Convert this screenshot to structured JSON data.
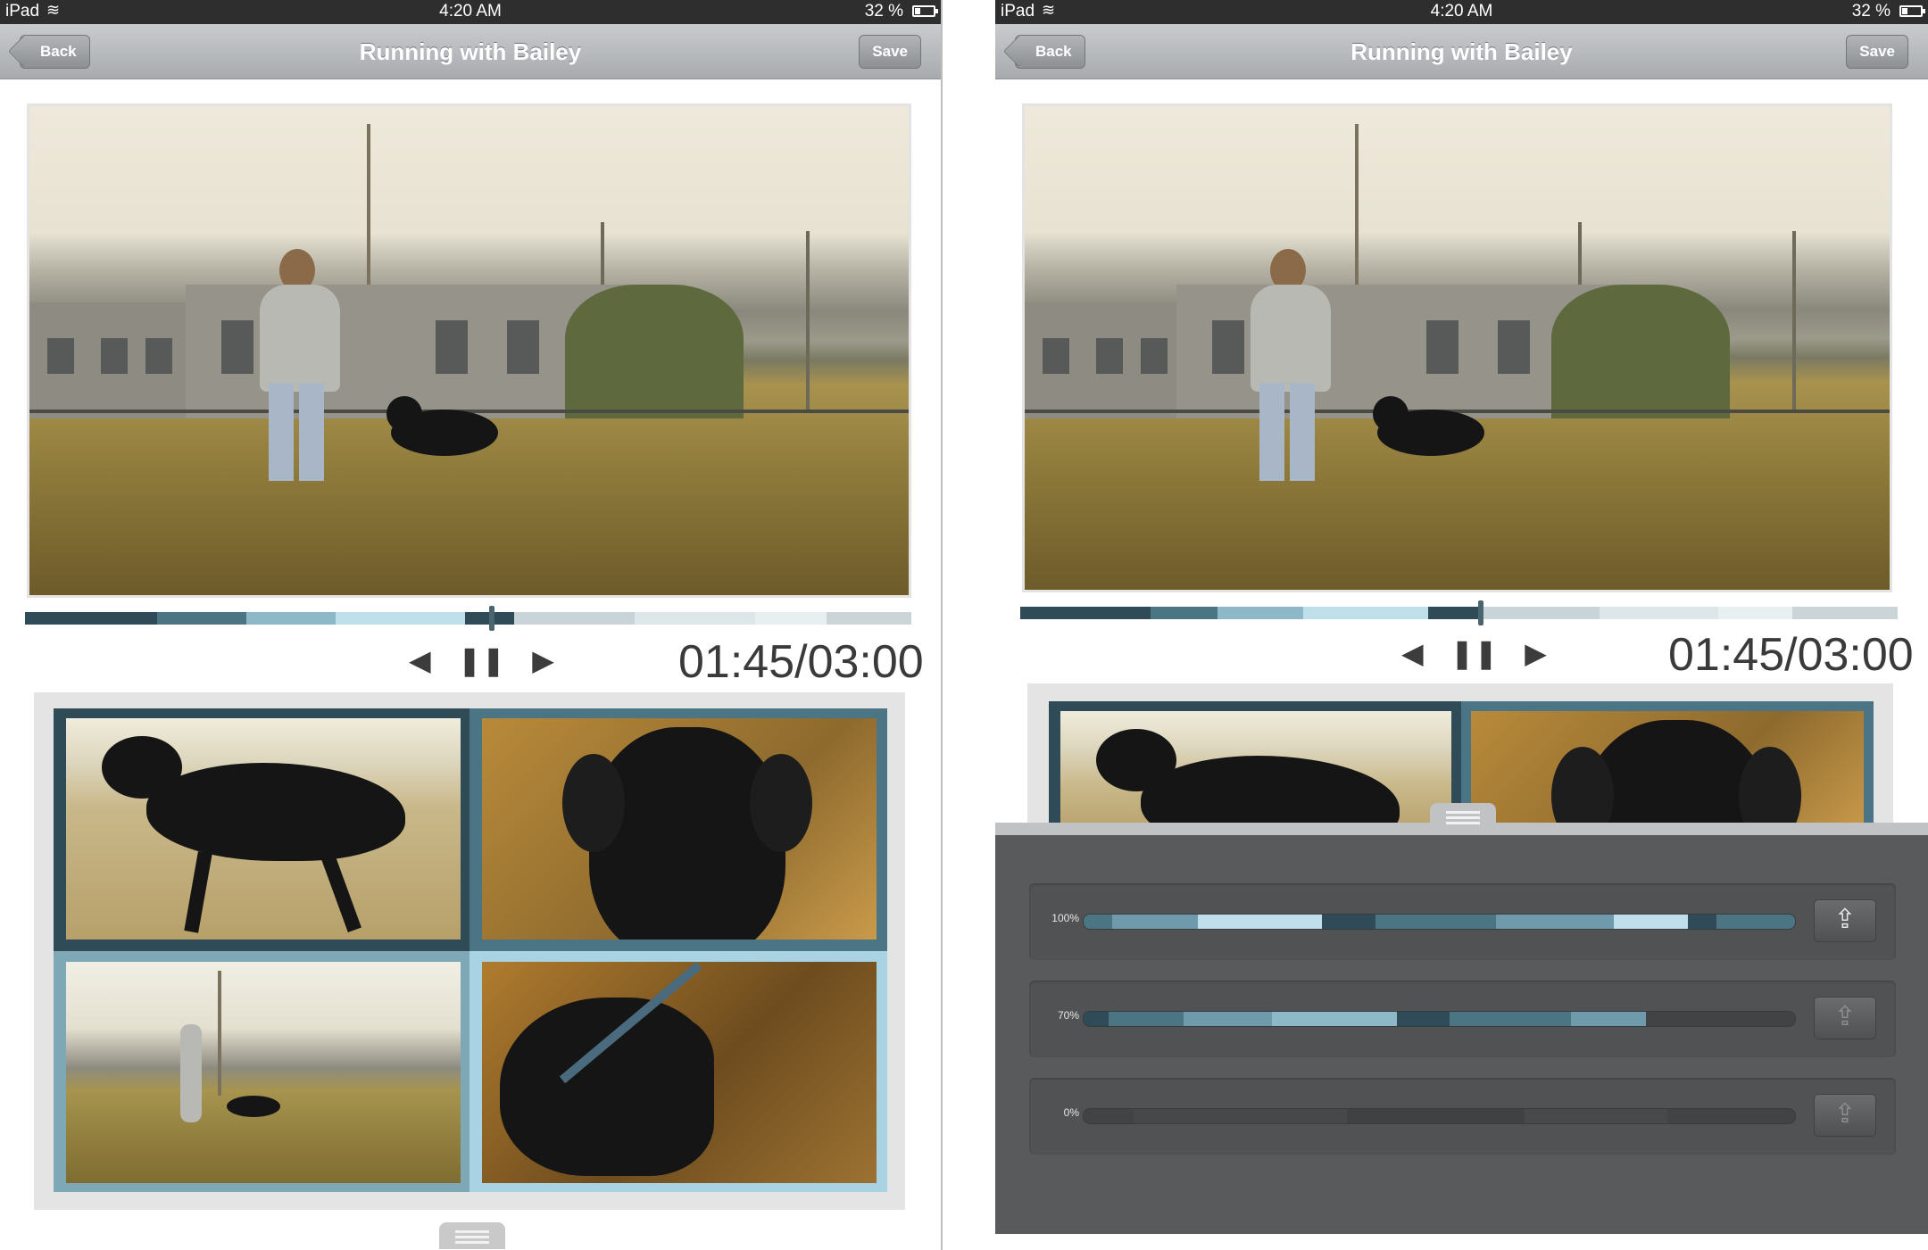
{
  "status_bar": {
    "carrier": "iPad",
    "time": "4:20 AM",
    "battery": "32 %"
  },
  "nav": {
    "title": "Running with Bailey",
    "back_label": "Back",
    "save_label": "Save"
  },
  "player": {
    "timecode": "01:45/03:00",
    "progress": 0.52
  },
  "icons": {
    "rewind": "rewind-icon",
    "pause": "pause-icon",
    "play": "play-icon",
    "share": "share-icon",
    "handle": "drawer-handle-icon",
    "wifi": "wifi-icon",
    "battery": "battery-icon"
  },
  "colors": {
    "segment_dark": "#2f4b57",
    "segment_mid": "#4c7584",
    "segment_light": "#8db8c8",
    "segment_pale": "#bfe0ea",
    "frame_gray": "#e3e3e3",
    "drawer_bg": "#595a5c"
  },
  "drawer": {
    "rows": [
      {
        "percent": "100%",
        "fill": 1.0
      },
      {
        "percent": "70%",
        "fill": 0.79
      },
      {
        "percent": "0%",
        "fill": 0.0
      }
    ]
  }
}
